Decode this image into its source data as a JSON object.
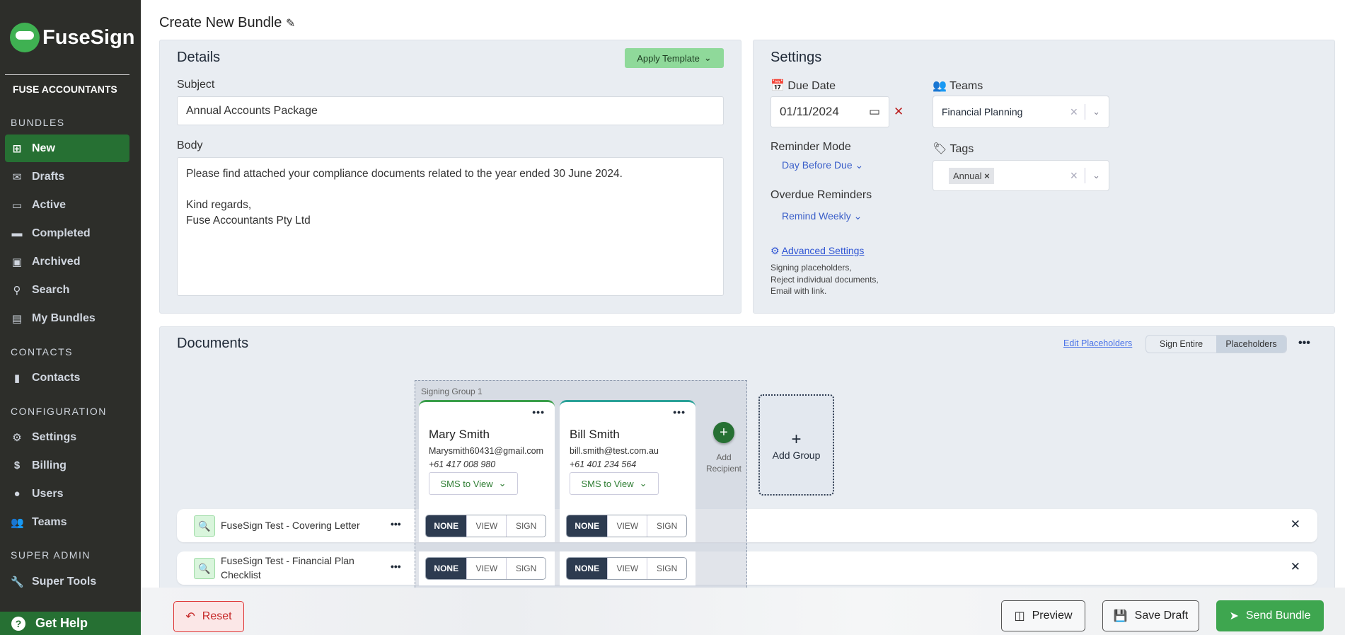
{
  "app": {
    "name": "FuseSign",
    "org": "FUSE ACCOUNTANTS",
    "brand_color": "#267033"
  },
  "sidebar": {
    "sections": [
      {
        "title": "BUNDLES",
        "items": [
          {
            "label": "New",
            "icon": "folder-plus-icon",
            "active": true
          },
          {
            "label": "Drafts",
            "icon": "envelope-open-icon"
          },
          {
            "label": "Active",
            "icon": "folder-outline-icon"
          },
          {
            "label": "Completed",
            "icon": "folder-icon"
          },
          {
            "label": "Archived",
            "icon": "archive-icon"
          },
          {
            "label": "Search",
            "icon": "search-icon"
          },
          {
            "label": "My Bundles",
            "icon": "chart-file-icon"
          }
        ]
      },
      {
        "title": "CONTACTS",
        "items": [
          {
            "label": "Contacts",
            "icon": "contact-file-icon"
          }
        ]
      },
      {
        "title": "CONFIGURATION",
        "items": [
          {
            "label": "Settings",
            "icon": "gear-icon"
          },
          {
            "label": "Billing",
            "icon": "dollar-icon"
          },
          {
            "label": "Users",
            "icon": "user-icon"
          },
          {
            "label": "Teams",
            "icon": "users-icon"
          }
        ]
      },
      {
        "title": "SUPER ADMIN",
        "items": [
          {
            "label": "Super Tools",
            "icon": "wrench-icon"
          }
        ]
      }
    ],
    "help": "Get Help"
  },
  "page": {
    "title": "Create New Bundle"
  },
  "details": {
    "title": "Details",
    "apply_template": "Apply Template",
    "subject_label": "Subject",
    "subject_value": "Annual Accounts Package",
    "body_label": "Body",
    "body_value": "Please find attached your compliance documents related to the year ended 30 June 2024.\n\nKind regards,\nFuse Accountants Pty Ltd"
  },
  "settings": {
    "title": "Settings",
    "due_date_label": "Due Date",
    "due_date_value": "01/11/2024",
    "reminder_mode_label": "Reminder Mode",
    "reminder_mode_value": "Day Before Due",
    "overdue_label": "Overdue Reminders",
    "overdue_value": "Remind Weekly",
    "advanced_link": "Advanced Settings",
    "advanced_desc": [
      "Signing placeholders,",
      "Reject individual documents,",
      "Email with link."
    ],
    "teams_label": "Teams",
    "teams_value": "Financial Planning",
    "tags_label": "Tags",
    "tags": [
      "Annual"
    ]
  },
  "documents": {
    "title": "Documents",
    "edit_placeholders": "Edit Placeholders",
    "modes": [
      "Sign Entire",
      "Placeholders"
    ],
    "active_mode": "Placeholders",
    "group": {
      "label": "Signing Group 1",
      "recipients": [
        {
          "name": "Mary Smith",
          "email": "Marysmith60431@gmail.com",
          "phone": "+61 417 008 980",
          "delivery": "SMS to View",
          "accent": "#3a9e4a"
        },
        {
          "name": "Bill Smith",
          "email": "bill.smith@test.com.au",
          "phone": "+61 401 234 564",
          "delivery": "SMS to View",
          "accent": "#2aa198"
        }
      ]
    },
    "add_recipient": "Add Recipient",
    "add_group": "Add Group",
    "permission_options": [
      "NONE",
      "VIEW",
      "SIGN"
    ],
    "rows": [
      {
        "name": "FuseSign Test - Covering Letter",
        "permissions": [
          "NONE",
          "NONE"
        ]
      },
      {
        "name": "FuseSign Test - Financial Plan Checklist",
        "permissions": [
          "NONE",
          "NONE"
        ]
      }
    ]
  },
  "footer": {
    "reset": "Reset",
    "preview": "Preview",
    "save_draft": "Save Draft",
    "send": "Send Bundle"
  }
}
